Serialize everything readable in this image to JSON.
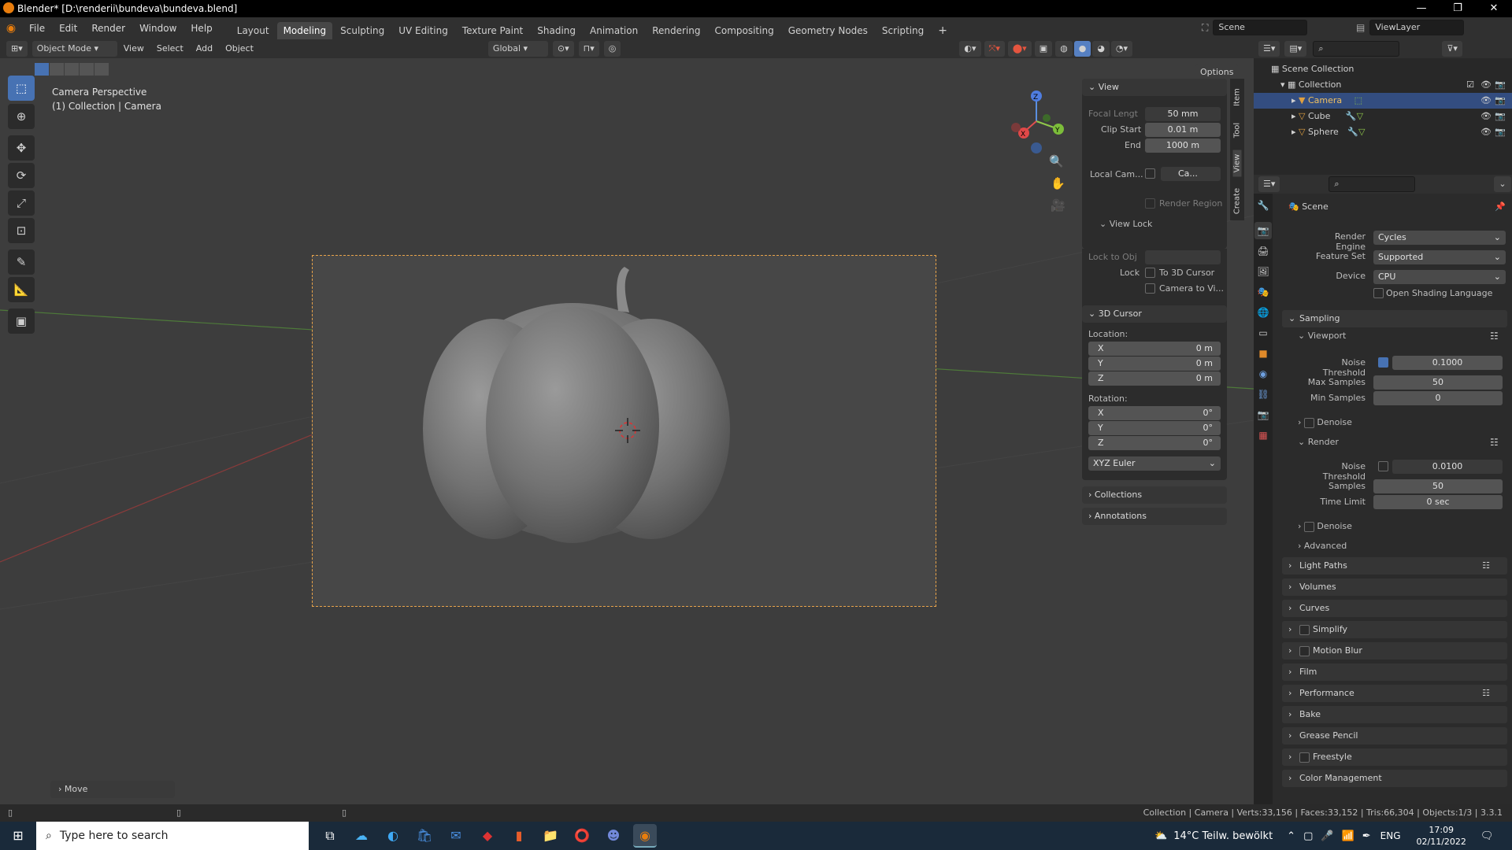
{
  "window": {
    "title": "Blender* [D:\\renderii\\bundeva\\bundeva.blend]"
  },
  "menus": [
    "File",
    "Edit",
    "Render",
    "Window",
    "Help"
  ],
  "workspaces": [
    "Layout",
    "Modeling",
    "Sculpting",
    "UV Editing",
    "Texture Paint",
    "Shading",
    "Animation",
    "Rendering",
    "Compositing",
    "Geometry Nodes",
    "Scripting"
  ],
  "active_workspace": "Modeling",
  "scene": {
    "label": "Scene",
    "view_layer": "ViewLayer"
  },
  "viewport_header": {
    "mode": "Object Mode",
    "menus": [
      "View",
      "Select",
      "Add",
      "Object"
    ],
    "orientation": "Global",
    "options": "Options"
  },
  "viewport": {
    "info_line1": "Camera Perspective",
    "info_line2": "(1) Collection | Camera",
    "gizmo": {
      "x": "X",
      "y": "Y",
      "z": "Z"
    }
  },
  "side_tabs": [
    "Item",
    "Tool",
    "View",
    "Create"
  ],
  "npanel": {
    "view": {
      "title": "View",
      "focal_label": "Focal Lengt",
      "focal_value": "50 mm",
      "clip_start_label": "Clip Start",
      "clip_start": "0.01 m",
      "end_label": "End",
      "end": "1000 m",
      "local_cam_label": "Local Cam...",
      "local_cam_value": "Ca...",
      "render_region": "Render Region"
    },
    "view_lock": {
      "title": "View Lock",
      "lock_obj_label": "Lock to Obj",
      "lock_label": "Lock",
      "to_3d_cursor": "To 3D Cursor",
      "camera_to_view": "Camera to Vi..."
    },
    "cursor": {
      "title": "3D Cursor",
      "location_label": "Location:",
      "loc": [
        {
          "axis": "X",
          "value": "0 m"
        },
        {
          "axis": "Y",
          "value": "0 m"
        },
        {
          "axis": "Z",
          "value": "0 m"
        }
      ],
      "rotation_label": "Rotation:",
      "rot": [
        {
          "axis": "X",
          "value": "0°"
        },
        {
          "axis": "Y",
          "value": "0°"
        },
        {
          "axis": "Z",
          "value": "0°"
        }
      ],
      "mode": "XYZ Euler"
    },
    "collections": "Collections",
    "annotations": "Annotations"
  },
  "redo_panel": "Move",
  "outliner": {
    "scene_collection": "Scene Collection",
    "collection": "Collection",
    "items": [
      "Camera",
      "Cube",
      "Sphere"
    ]
  },
  "properties": {
    "header": "Scene",
    "render_engine_label": "Render Engine",
    "render_engine": "Cycles",
    "feature_set_label": "Feature Set",
    "feature_set": "Supported",
    "device_label": "Device",
    "device": "CPU",
    "osl": "Open Shading Language",
    "sampling": "Sampling",
    "viewport": "Viewport",
    "noise_threshold_label": "Noise Threshold",
    "vp_noise_threshold": "0.1000",
    "max_samples_label": "Max Samples",
    "max_samples": "50",
    "min_samples_label": "Min Samples",
    "min_samples": "0",
    "denoise": "Denoise",
    "render": "Render",
    "r_noise_threshold": "0.0100",
    "samples_label": "Samples",
    "samples": "50",
    "time_limit_label": "Time Limit",
    "time_limit": "0 sec",
    "advanced": "Advanced",
    "sections": [
      "Light Paths",
      "Volumes",
      "Curves",
      "Simplify",
      "Motion Blur",
      "Film",
      "Performance",
      "Bake",
      "Grease Pencil",
      "Freestyle",
      "Color Management"
    ]
  },
  "status_bar": "Collection | Camera | Verts:33,156 | Faces:33,152 | Tris:66,304 | Objects:1/3 | 3.3.1",
  "taskbar": {
    "search": "Type here to search",
    "weather": "14°C  Teilw. bewölkt",
    "lang": "ENG",
    "time": "17:09",
    "date": "02/11/2022"
  }
}
